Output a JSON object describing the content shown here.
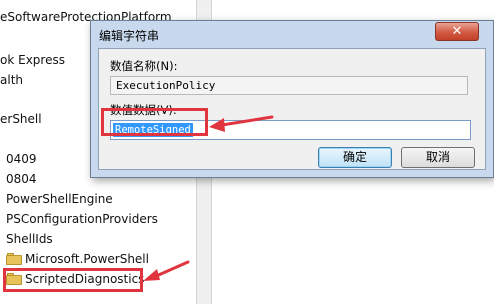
{
  "tree": {
    "items": [
      {
        "label": "eSoftwareProtectionPlatform",
        "has_folder": false
      },
      {
        "label": "ok Express",
        "has_folder": false
      },
      {
        "label": "alth",
        "has_folder": false
      },
      {
        "label": "erShell",
        "has_folder": false
      },
      {
        "label": "0409",
        "has_folder": false
      },
      {
        "label": "0804",
        "has_folder": false
      },
      {
        "label": "PowerShellEngine",
        "has_folder": false
      },
      {
        "label": "PSConfigurationProviders",
        "has_folder": false
      },
      {
        "label": "ShellIds",
        "has_folder": false
      },
      {
        "label": "Microsoft.PowerShell",
        "has_folder": true
      },
      {
        "label": "ScriptedDiagnostics",
        "has_folder": true
      }
    ]
  },
  "dialog": {
    "title": "编辑字符串",
    "close_glyph": "✕",
    "value_name_label": "数值名称(N):",
    "value_name": "ExecutionPolicy",
    "value_data_label": "数值数据(V):",
    "value_data": "RemoteSigned",
    "ok_label": "确定",
    "cancel_label": "取消"
  },
  "annotations": {
    "color": "#e0353e"
  },
  "colors": {
    "dialog_frame": "#c9d9ed",
    "selection": "#3399ff",
    "folder": "#e8c35a"
  }
}
